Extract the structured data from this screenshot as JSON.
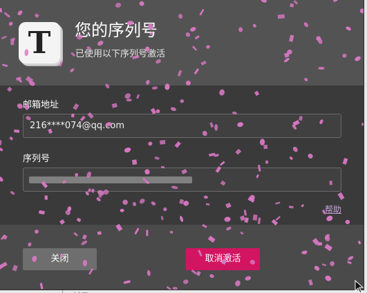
{
  "dialog": {
    "title": "您的序列号",
    "subtitle": "已使用以下序列号激活",
    "app_icon_letter": "T"
  },
  "form": {
    "email_label": "邮箱地址",
    "email_value": "216****074@qq.com",
    "serial_label": "序列号",
    "serial_value": "",
    "help_link": "帮助"
  },
  "buttons": {
    "close_label": "关闭",
    "deactivate_label": "取消激活"
  },
  "background": {
    "peek_label": "试用"
  },
  "colors": {
    "dialog_bg": "#4a4a4a",
    "form_bg": "#3a3a3a",
    "accent": "#d11561",
    "confetti": "#d978c4",
    "link": "#c5a2d8"
  },
  "icons": {
    "app": "typora-t-icon",
    "cursor": "mouse-pointer-icon"
  }
}
